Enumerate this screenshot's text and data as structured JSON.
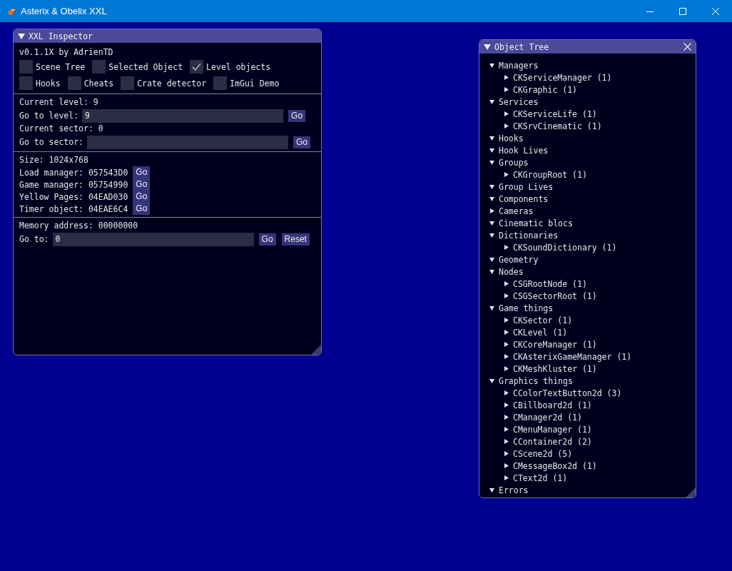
{
  "window": {
    "title": "Asterix & Obelix XXL"
  },
  "inspector": {
    "title": "XXL Inspector",
    "version": "v0.1.1X by AdrienTD",
    "checkbox_rows": [
      [
        {
          "label": "Scene Tree",
          "checked": false
        },
        {
          "label": "Selected Object",
          "checked": false
        },
        {
          "label": "Level objects",
          "checked": true
        }
      ],
      [
        {
          "label": "Hooks",
          "checked": false
        },
        {
          "label": "Cheats",
          "checked": false
        },
        {
          "label": "Crate detector",
          "checked": false
        },
        {
          "label": "ImGui Demo",
          "checked": false
        }
      ]
    ],
    "sections": [
      [
        {
          "kind": "text",
          "text": "Current level: 9"
        },
        {
          "kind": "input",
          "label": "Go to level:",
          "value": "9",
          "buttons": [
            "Go"
          ]
        },
        {
          "kind": "text",
          "text": "Current sector: 0"
        },
        {
          "kind": "input",
          "label": "Go to sector:",
          "buttons": [
            "Go"
          ]
        }
      ],
      [
        {
          "kind": "text",
          "text": "Size: 1024x768"
        },
        {
          "kind": "pointer",
          "text": "Load manager: 057543D0",
          "buttons": [
            "Go"
          ]
        },
        {
          "kind": "pointer",
          "text": "Game manager: 05754990",
          "buttons": [
            "Go"
          ]
        },
        {
          "kind": "pointer",
          "text": "Yellow Pages: 04EAD030",
          "buttons": [
            "Go"
          ]
        },
        {
          "kind": "pointer",
          "text": "Timer object: 04EAE6C4",
          "buttons": [
            "Go"
          ]
        }
      ],
      [
        {
          "kind": "text",
          "text": "Memory address: 00000000"
        },
        {
          "kind": "input",
          "label": "Go to:",
          "value": "0",
          "buttons": [
            "Go",
            "Reset"
          ]
        }
      ]
    ]
  },
  "object_tree": {
    "title": "Object Tree",
    "nodes": [
      {
        "label": "Managers",
        "expanded": true,
        "children": [
          {
            "label": "CKServiceManager (1)",
            "expanded": false
          },
          {
            "label": "CKGraphic (1)",
            "expanded": false
          }
        ]
      },
      {
        "label": "Services",
        "expanded": true,
        "children": [
          {
            "label": "CKServiceLife (1)",
            "expanded": false
          },
          {
            "label": "CKSrvCinematic (1)",
            "expanded": false
          }
        ]
      },
      {
        "label": "Hooks",
        "expanded": true
      },
      {
        "label": "Hook Lives",
        "expanded": true
      },
      {
        "label": "Groups",
        "expanded": true,
        "children": [
          {
            "label": "CKGroupRoot (1)",
            "expanded": false
          }
        ]
      },
      {
        "label": "Group Lives",
        "expanded": true
      },
      {
        "label": "Components",
        "expanded": true
      },
      {
        "label": "Cameras",
        "expanded": false
      },
      {
        "label": "Cinematic blocs",
        "expanded": true
      },
      {
        "label": "Dictionaries",
        "expanded": true,
        "children": [
          {
            "label": "CKSoundDictionary (1)",
            "expanded": false
          }
        ]
      },
      {
        "label": "Geometry",
        "expanded": true
      },
      {
        "label": "Nodes",
        "expanded": true,
        "children": [
          {
            "label": "CSGRootNode (1)",
            "expanded": false
          },
          {
            "label": "CSGSectorRoot (1)",
            "expanded": false
          }
        ]
      },
      {
        "label": "Game things",
        "expanded": true,
        "children": [
          {
            "label": "CKSector (1)",
            "expanded": false
          },
          {
            "label": "CKLevel (1)",
            "expanded": false
          },
          {
            "label": "CKCoreManager (1)",
            "expanded": false
          },
          {
            "label": "CKAsterixGameManager (1)",
            "expanded": false
          },
          {
            "label": "CKMeshKluster (1)",
            "expanded": false
          }
        ]
      },
      {
        "label": "Graphics things",
        "expanded": true,
        "children": [
          {
            "label": "CColorTextButton2d (3)",
            "expanded": false
          },
          {
            "label": "CBillboard2d (1)",
            "expanded": false
          },
          {
            "label": "CManager2d (1)",
            "expanded": false
          },
          {
            "label": "CMenuManager (1)",
            "expanded": false
          },
          {
            "label": "CContainer2d (2)",
            "expanded": false
          },
          {
            "label": "CScene2d (5)",
            "expanded": false
          },
          {
            "label": "CMessageBox2d (1)",
            "expanded": false
          },
          {
            "label": "CText2d (1)",
            "expanded": false
          }
        ]
      },
      {
        "label": "Errors",
        "expanded": true
      }
    ]
  }
}
